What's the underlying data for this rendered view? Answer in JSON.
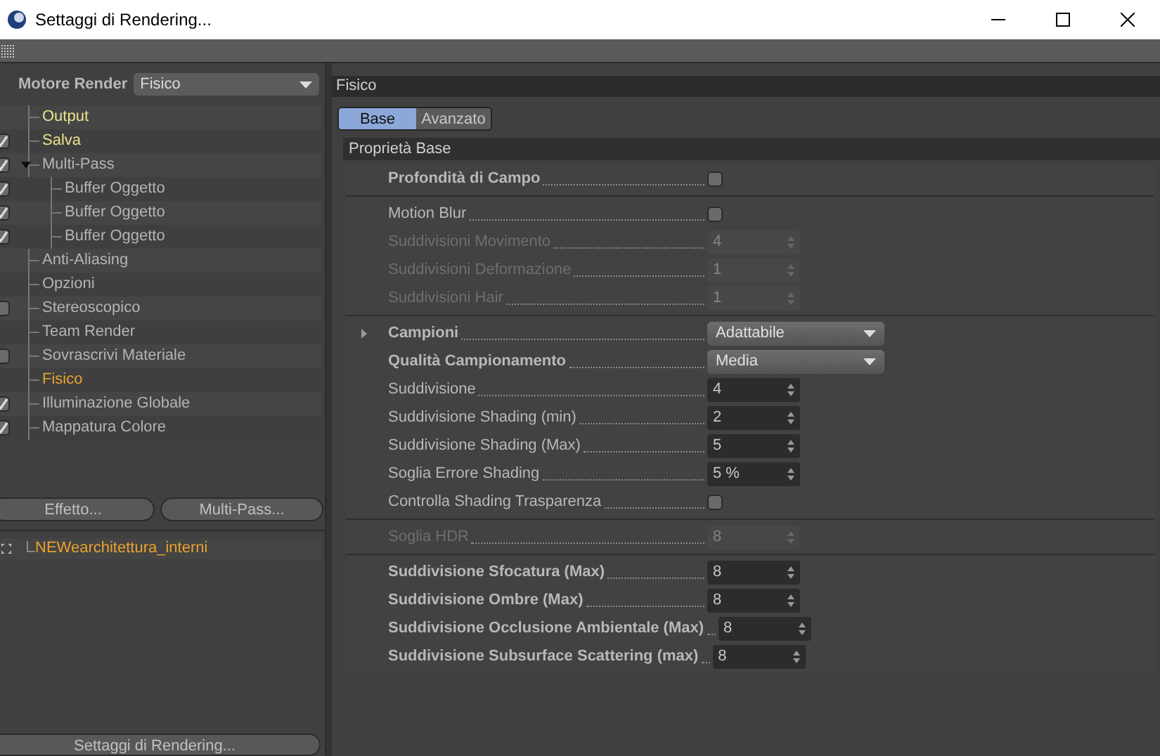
{
  "window": {
    "title": "Settaggi di Rendering..."
  },
  "renderer": {
    "label": "Motore Render",
    "value": "Fisico"
  },
  "settings_tree": [
    {
      "label": "Output",
      "color": "#e8e48c",
      "kind": "plain"
    },
    {
      "label": "Salva",
      "color": "#e8e48c",
      "kind": "toggle",
      "checked": true
    },
    {
      "label": "Multi-Pass",
      "color": "#b4b4b4",
      "kind": "toggle",
      "checked": true,
      "expanded": true,
      "children": [
        {
          "label": "Buffer Oggetto",
          "color": "#b4b4b4",
          "kind": "toggle",
          "checked": true
        },
        {
          "label": "Buffer Oggetto",
          "color": "#b4b4b4",
          "kind": "toggle",
          "checked": true
        },
        {
          "label": "Buffer Oggetto",
          "color": "#b4b4b4",
          "kind": "toggle",
          "checked": true
        }
      ]
    },
    {
      "label": "Anti-Aliasing",
      "color": "#b4b4b4",
      "kind": "plain"
    },
    {
      "label": "Opzioni",
      "color": "#b4b4b4",
      "kind": "plain"
    },
    {
      "label": "Stereoscopico",
      "color": "#b4b4b4",
      "kind": "toggle",
      "checked": false
    },
    {
      "label": "Team Render",
      "color": "#b4b4b4",
      "kind": "plain"
    },
    {
      "label": "Sovrascrivi Materiale",
      "color": "#b4b4b4",
      "kind": "toggle",
      "checked": false
    },
    {
      "label": "Fisico",
      "color": "#eba22e",
      "kind": "plain"
    },
    {
      "label": "Illuminazione Globale",
      "color": "#b4b4b4",
      "kind": "toggle",
      "checked": true
    },
    {
      "label": "Mappatura Colore",
      "color": "#b4b4b4",
      "kind": "toggle",
      "checked": true
    }
  ],
  "buttons": [
    "Effetto...",
    "Multi-Pass..."
  ],
  "scene_tree": [
    {
      "label": "NEWearchitettura_interni",
      "color": "#eba22e"
    }
  ],
  "bottom_button": "Settaggi di Rendering...",
  "panel": {
    "title": "Fisico",
    "tabs": [
      {
        "label": "Base",
        "selected": true
      },
      {
        "label": "Avanzato",
        "selected": false
      }
    ],
    "section": "Proprietà Base",
    "groups": [
      [
        {
          "label": "Profondità di Campo",
          "kind": "checkbox",
          "bold": true,
          "disabled": false,
          "checked": false
        }
      ],
      [
        {
          "label": "Motion Blur",
          "kind": "checkbox",
          "bold": false,
          "disabled": false,
          "checked": false
        },
        {
          "label": "Suddivisioni Movimento",
          "kind": "number",
          "bold": false,
          "disabled": true,
          "value": "4"
        },
        {
          "label": "Suddivisioni Deformazione",
          "kind": "number",
          "bold": false,
          "disabled": true,
          "value": "1"
        },
        {
          "label": "Suddivisioni Hair",
          "kind": "number",
          "bold": false,
          "disabled": true,
          "value": "1"
        }
      ],
      [
        {
          "label": "Campioni",
          "kind": "dropdown",
          "bold": true,
          "disabled": false,
          "expanded": false,
          "value": "Adattabile"
        },
        {
          "label": "Qualità Campionamento",
          "kind": "dropdown",
          "bold": true,
          "disabled": false,
          "value": "Media"
        },
        {
          "label": "Suddivisione",
          "kind": "number",
          "bold": false,
          "disabled": false,
          "value": "4"
        },
        {
          "label": "Suddivisione Shading (min)",
          "kind": "number",
          "bold": false,
          "disabled": false,
          "value": "2"
        },
        {
          "label": "Suddivisione Shading (Max)",
          "kind": "number",
          "bold": false,
          "disabled": false,
          "value": "5"
        },
        {
          "label": "Soglia Errore Shading",
          "kind": "number",
          "bold": false,
          "disabled": false,
          "value": "5 %"
        },
        {
          "label": "Controlla Shading Trasparenza",
          "kind": "checkbox",
          "bold": false,
          "disabled": false,
          "checked": false
        }
      ],
      [
        {
          "label": "Soglia HDR",
          "kind": "number",
          "bold": false,
          "disabled": true,
          "value": "8"
        }
      ],
      [
        {
          "label": "Suddivisione Sfocatura (Max)",
          "kind": "number",
          "bold": true,
          "disabled": false,
          "value": "8"
        },
        {
          "label": "Suddivisione Ombre (Max)",
          "kind": "number",
          "bold": true,
          "disabled": false,
          "value": "8"
        },
        {
          "label": "Suddivisione Occlusione Ambientale (Max)",
          "kind": "number",
          "bold": true,
          "disabled": false,
          "value": "8"
        },
        {
          "label": "Suddivisione Subsurface Scattering (max)",
          "kind": "number",
          "bold": true,
          "disabled": false,
          "value": "8"
        }
      ]
    ]
  }
}
